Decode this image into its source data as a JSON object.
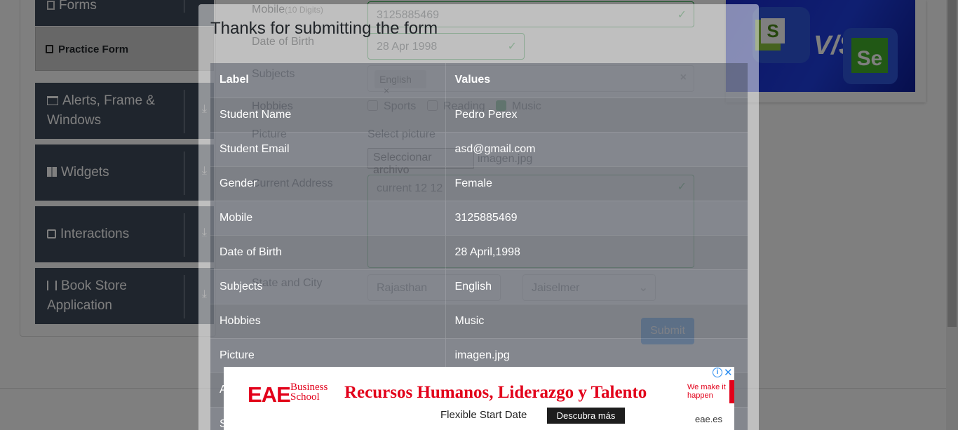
{
  "sidebar": {
    "forms_label": "Forms",
    "practice_form": "Practice Form",
    "groups": [
      {
        "label": "Alerts, Frame & Windows"
      },
      {
        "label": "Widgets"
      },
      {
        "label": "Interactions"
      },
      {
        "label": "Book Store Application"
      }
    ]
  },
  "form": {
    "mobile_label": "Mobile",
    "mobile_hint": "(10 Digits)",
    "mobile_value": "3125885469",
    "dob_label": "Date of Birth",
    "dob_value": "28 Apr 1998",
    "subjects_label": "Subjects",
    "subject_chip": "English",
    "hobbies_label": "Hobbies",
    "hobby_sports": "Sports",
    "hobby_reading": "Reading",
    "hobby_music": "Music",
    "picture_label": "Picture",
    "picture_caption": "Select picture",
    "file_button": "Seleccionar archivo",
    "file_name": "imagen.jpg",
    "address_label": "Current Address",
    "address_value": "current 12 12",
    "state_city_label": "State and City",
    "state_value": "Rajasthan",
    "city_value": "Jaiselmer",
    "submit_label": "Submit"
  },
  "modal": {
    "title": "Thanks for submitting the form",
    "headers": {
      "label": "Label",
      "values": "Values"
    },
    "rows": [
      {
        "label": "Student Name",
        "value": "Pedro Perex"
      },
      {
        "label": "Student Email",
        "value": "asd@gmail.com"
      },
      {
        "label": "Gender",
        "value": "Female"
      },
      {
        "label": "Mobile",
        "value": "3125885469"
      },
      {
        "label": "Date of Birth",
        "value": "28 April,1998"
      },
      {
        "label": "Subjects",
        "value": "English"
      },
      {
        "label": "Hobbies",
        "value": "Music"
      },
      {
        "label": "Picture",
        "value": "imagen.jpg"
      },
      {
        "label": "A",
        "value": ""
      },
      {
        "label": "S",
        "value": ""
      }
    ]
  },
  "ad": {
    "brand": "EAE",
    "brand_sub": "Business School",
    "headline": "Recursos Humanos, Liderazgo y Talento",
    "tagline": "We make it happen",
    "subline": "Flexible Start Date",
    "cta": "Descubra más",
    "domain": "eae.es",
    "info_glyph": "i",
    "close_glyph": "✕"
  },
  "colors": {
    "accent_green": "#28a745",
    "brand_red": "#e2001a",
    "sidebar_dark": "#3f4a5a"
  }
}
